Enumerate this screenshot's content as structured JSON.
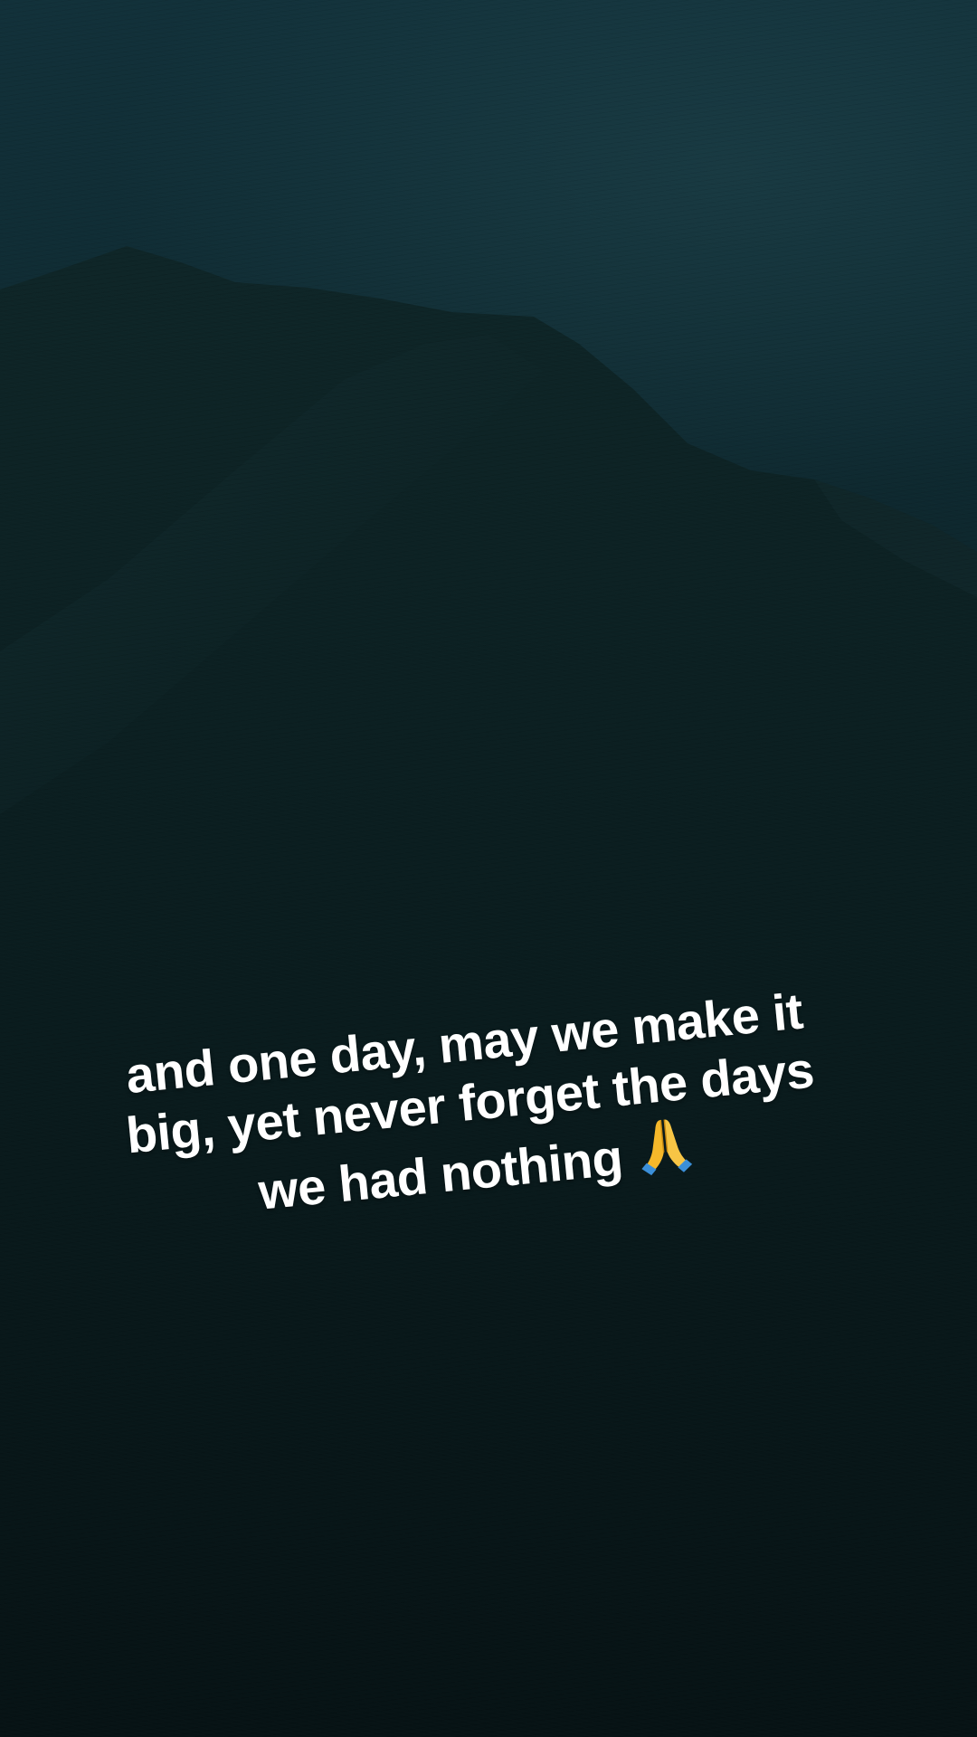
{
  "caption": {
    "line1": "and one day, may we make it",
    "line2": "big, yet never forget the days",
    "line3": "we had nothing"
  },
  "icons": {
    "emoji": "pray-icon"
  },
  "colors": {
    "sky": "#12313a",
    "mountain": "#0b1e20",
    "text": "#ffffff",
    "emoji_hand": "#f5b82a",
    "emoji_sleeve": "#3b8fd9"
  }
}
